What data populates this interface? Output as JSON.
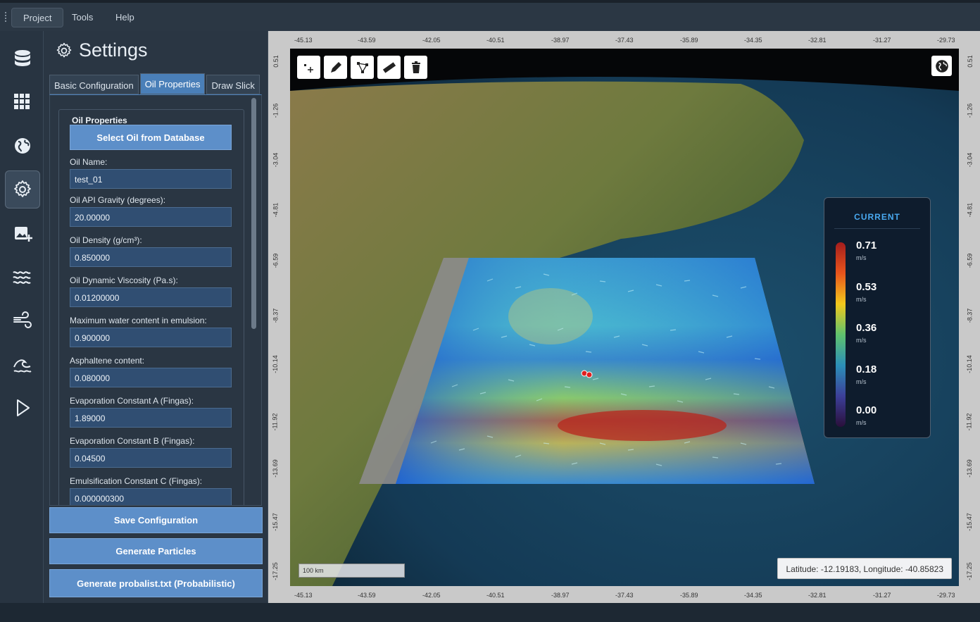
{
  "menu": {
    "items": [
      "Project",
      "Tools",
      "Help"
    ]
  },
  "sidebar_icons": [
    "database-icon",
    "grid-icon",
    "globe-icon",
    "gear-icon",
    "add-image-icon",
    "waves-icon",
    "wind-icon",
    "ocean-wave-icon",
    "play-icon"
  ],
  "settings": {
    "title": "Settings",
    "tabs": [
      "Basic Configuration",
      "Oil Properties",
      "Draw Slick"
    ],
    "active_tab": "Oil Properties",
    "group_title": "Oil Properties",
    "select_button": "Select Oil from Database",
    "fields": [
      {
        "label": "Oil Name:",
        "value": "test_01"
      },
      {
        "label": "Oil API Gravity (degrees):",
        "value": "20.00000"
      },
      {
        "label": "Oil Density (g/cm³):",
        "value": "0.850000"
      },
      {
        "label": "Oil Dynamic Viscosity (Pa.s):",
        "value": "0.01200000"
      },
      {
        "label": "Maximum water content in emulsion:",
        "value": "0.900000"
      },
      {
        "label": "Asphaltene content:",
        "value": "0.080000"
      },
      {
        "label": "Evaporation Constant A (Fingas):",
        "value": "1.89000"
      },
      {
        "label": "Evaporation Constant B (Fingas):",
        "value": "0.04500"
      },
      {
        "label": "Emulsification Constant C (Fingas):",
        "value": "0.000000300"
      }
    ],
    "actions": [
      "Save Configuration",
      "Generate Particles",
      "Generate probalist.txt (Probabilistic)"
    ]
  },
  "map": {
    "lon_ticks": [
      "-45.13",
      "-43.59",
      "-42.05",
      "-40.51",
      "-38.97",
      "-37.43",
      "-35.89",
      "-34.35",
      "-32.81",
      "-31.27",
      "-29.73"
    ],
    "lat_ticks": [
      "0.51",
      "-1.26",
      "-3.04",
      "-4.81",
      "-6.59",
      "-8.37",
      "-10.14",
      "-11.92",
      "-13.69",
      "-15.47",
      "-17.25"
    ],
    "tools": [
      "add-point-icon",
      "pencil-icon",
      "polygon-icon",
      "ruler-icon",
      "trash-icon"
    ],
    "legend": {
      "title": "CURRENT",
      "values": [
        "0.71",
        "0.53",
        "0.36",
        "0.18",
        "0.00"
      ],
      "unit": "m/s"
    },
    "scale_label": "100 km",
    "cursor": "Latitude: -12.19183, Longitude: -40.85823"
  }
}
